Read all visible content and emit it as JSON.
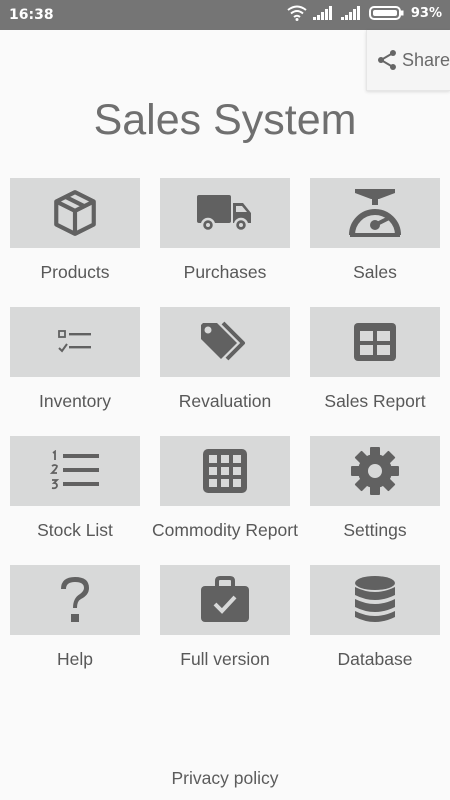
{
  "status_bar": {
    "time": "16:38",
    "battery": "93%",
    "icons": [
      "wifi-icon",
      "signal-icon",
      "signal-icon",
      "battery-icon"
    ]
  },
  "share": {
    "label": "Share",
    "icon": "share-icon"
  },
  "title": "Sales System",
  "menu": [
    {
      "label": "Products",
      "icon": "box-icon"
    },
    {
      "label": "Purchases",
      "icon": "truck-icon"
    },
    {
      "label": "Sales",
      "icon": "scale-icon"
    },
    {
      "label": "Inventory",
      "icon": "checklist-icon"
    },
    {
      "label": "Revaluation",
      "icon": "tags-icon"
    },
    {
      "label": "Sales Report",
      "icon": "table-icon"
    },
    {
      "label": "Stock List",
      "icon": "numbered-list-icon"
    },
    {
      "label": "Commodity Report",
      "icon": "grid-icon"
    },
    {
      "label": "Settings",
      "icon": "gear-icon"
    },
    {
      "label": "Help",
      "icon": "question-icon"
    },
    {
      "label": "Full version",
      "icon": "briefcase-check-icon"
    },
    {
      "label": "Database",
      "icon": "database-icon"
    }
  ],
  "footer": {
    "privacy": "Privacy policy"
  },
  "colors": {
    "icon": "#616161",
    "tile": "#d8d9d9",
    "status_bar": "#757575",
    "text": "#585858"
  }
}
